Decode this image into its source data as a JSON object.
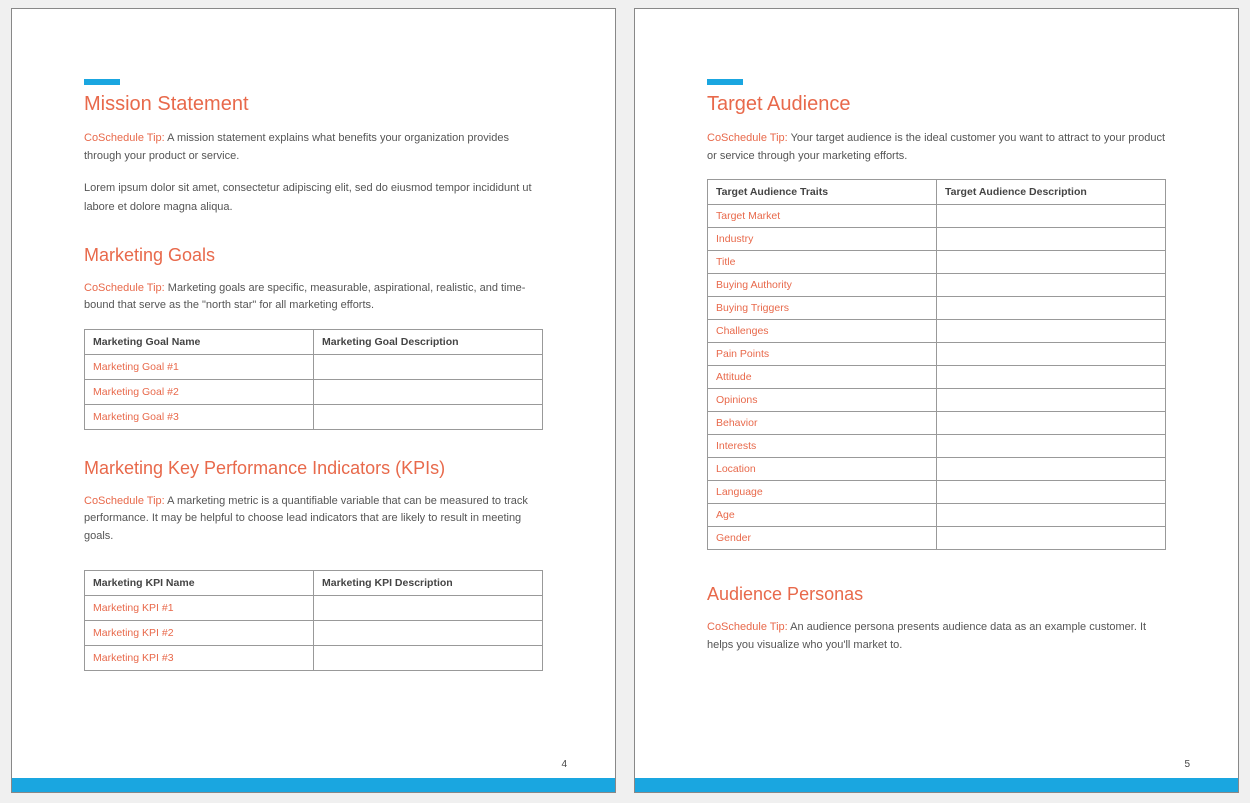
{
  "page_left": {
    "number": "4",
    "mission": {
      "title": "Mission Statement",
      "tip_label": "CoSchedule Tip:",
      "tip_text": " A mission statement explains what benefits your organization provides through your product or service.",
      "body": "Lorem ipsum dolor sit amet, consectetur adipiscing elit, sed do eiusmod tempor incididunt ut labore et dolore magna aliqua."
    },
    "goals": {
      "title": "Marketing Goals",
      "tip_label": "CoSchedule Tip:",
      "tip_text": " Marketing goals are specific, measurable, aspirational, realistic, and time-bound that serve as the \"north star\" for all marketing efforts.",
      "table": {
        "header_name": "Marketing Goal Name",
        "header_desc": "Marketing Goal Description",
        "rows": [
          {
            "name": "Marketing Goal #1",
            "desc": ""
          },
          {
            "name": "Marketing Goal #2",
            "desc": ""
          },
          {
            "name": "Marketing Goal #3",
            "desc": ""
          }
        ]
      }
    },
    "kpis": {
      "title": "Marketing Key Performance Indicators (KPIs)",
      "tip_label": "CoSchedule Tip:",
      "tip_text": " A marketing metric is a quantifiable variable that can be measured to track performance. It may be helpful to choose lead indicators that are likely to result in meeting goals.",
      "table": {
        "header_name": "Marketing KPI Name",
        "header_desc": "Marketing KPI Description",
        "rows": [
          {
            "name": "Marketing KPI #1",
            "desc": ""
          },
          {
            "name": "Marketing KPI #2",
            "desc": ""
          },
          {
            "name": "Marketing KPI #3",
            "desc": ""
          }
        ]
      }
    }
  },
  "page_right": {
    "number": "5",
    "target": {
      "title": "Target Audience",
      "tip_label": "CoSchedule Tip:",
      "tip_text": " Your target audience is the ideal customer you want to attract to your product or service through your marketing efforts.",
      "table": {
        "header_name": "Target Audience Traits",
        "header_desc": "Target Audience Description",
        "rows": [
          {
            "name": "Target Market",
            "desc": ""
          },
          {
            "name": "Industry",
            "desc": ""
          },
          {
            "name": "Title",
            "desc": ""
          },
          {
            "name": "Buying Authority",
            "desc": ""
          },
          {
            "name": "Buying Triggers",
            "desc": ""
          },
          {
            "name": "Challenges",
            "desc": ""
          },
          {
            "name": "Pain Points",
            "desc": ""
          },
          {
            "name": "Attitude",
            "desc": ""
          },
          {
            "name": "Opinions",
            "desc": ""
          },
          {
            "name": "Behavior",
            "desc": ""
          },
          {
            "name": "Interests",
            "desc": ""
          },
          {
            "name": "Location",
            "desc": ""
          },
          {
            "name": "Language",
            "desc": ""
          },
          {
            "name": "Age",
            "desc": ""
          },
          {
            "name": "Gender",
            "desc": ""
          }
        ]
      }
    },
    "personas": {
      "title": "Audience Personas",
      "tip_label": "CoSchedule Tip:",
      "tip_text": " An audience persona presents audience data as an example customer. It helps you visualize who you'll market to."
    }
  }
}
